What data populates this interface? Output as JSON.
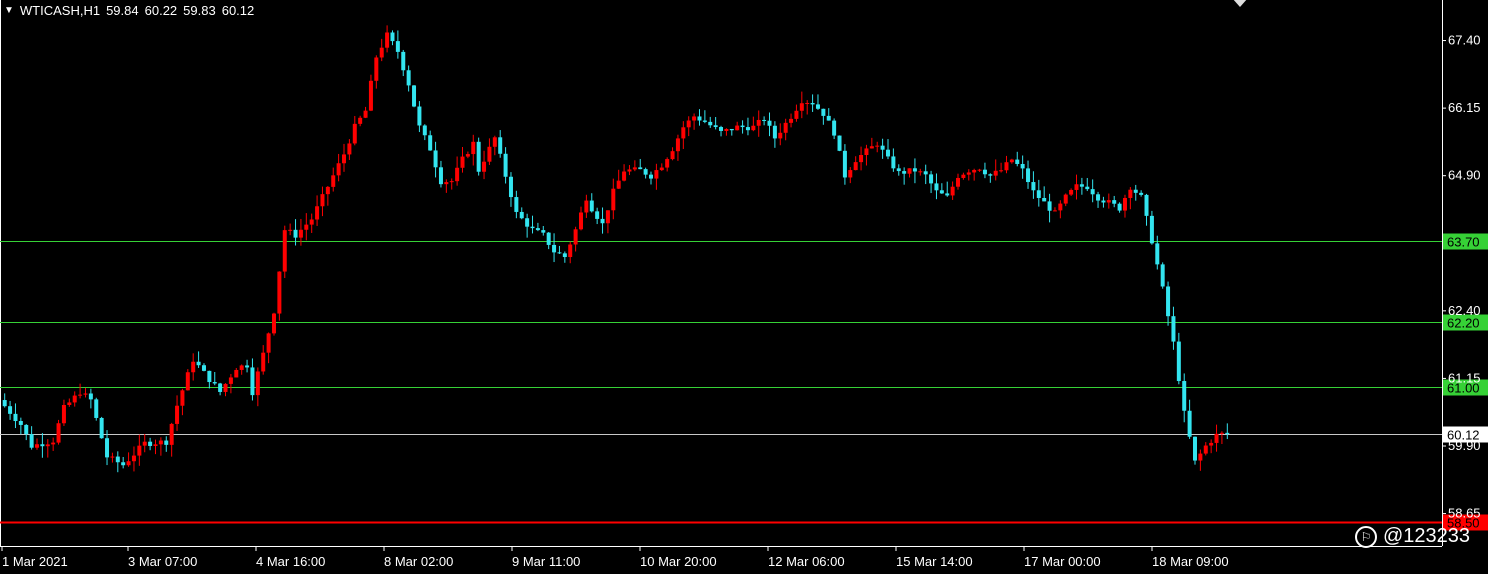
{
  "header": {
    "symbol": "WTICASH,H1",
    "open": "59.84",
    "high": "60.22",
    "low": "59.83",
    "close": "60.12"
  },
  "watermark": "@123233",
  "colors": {
    "background": "#000000",
    "bull": "#ff0000",
    "bear": "#33e5f0",
    "level_line": "#36d136",
    "support_line": "#ff0000",
    "current_line": "#c8c8c8",
    "axis_text": "#ffffff"
  },
  "chart_data": {
    "type": "candlestick",
    "y_axis_ticks": [
      "67.40",
      "66.15",
      "64.90",
      "62.40",
      "61.15",
      "59.90",
      "58.65"
    ],
    "ylim": [
      58.05,
      68.15
    ],
    "x_axis_labels": [
      "1 Mar 2021",
      "3 Mar 07:00",
      "4 Mar 16:00",
      "8 Mar 02:00",
      "9 Mar 11:00",
      "10 Mar 20:00",
      "12 Mar 06:00",
      "15 Mar 14:00",
      "17 Mar 00:00",
      "18 Mar 09:00"
    ],
    "levels": [
      {
        "value": 63.7,
        "label": "63.70",
        "kind": "resistance"
      },
      {
        "value": 62.2,
        "label": "62.20",
        "kind": "resistance"
      },
      {
        "value": 61.0,
        "label": "61.00",
        "kind": "resistance"
      },
      {
        "value": 58.5,
        "label": "58.50",
        "kind": "support"
      }
    ],
    "current_price": {
      "value": 60.12,
      "label": "60.12"
    },
    "price_path": [
      [
        0,
        60.75
      ],
      [
        4,
        60.3
      ],
      [
        6,
        59.9
      ],
      [
        10,
        60.0
      ],
      [
        12,
        60.6
      ],
      [
        15,
        60.9
      ],
      [
        17,
        60.75
      ],
      [
        20,
        59.7
      ],
      [
        23,
        59.55
      ],
      [
        27,
        59.95
      ],
      [
        31,
        59.98
      ],
      [
        33,
        60.65
      ],
      [
        36,
        61.5
      ],
      [
        38,
        61.25
      ],
      [
        41,
        60.9
      ],
      [
        44,
        61.35
      ],
      [
        46,
        61.4
      ],
      [
        47,
        60.9
      ],
      [
        49,
        61.6
      ],
      [
        51,
        62.4
      ],
      [
        53,
        63.9
      ],
      [
        55,
        63.8
      ],
      [
        58,
        64.1
      ],
      [
        61,
        64.7
      ],
      [
        64,
        65.3
      ],
      [
        66,
        65.8
      ],
      [
        68,
        66.1
      ],
      [
        70,
        67.1
      ],
      [
        72,
        67.5
      ],
      [
        74,
        67.2
      ],
      [
        76,
        66.6
      ],
      [
        78,
        65.8
      ],
      [
        80,
        65.4
      ],
      [
        82,
        64.8
      ],
      [
        84,
        64.8
      ],
      [
        86,
        65.2
      ],
      [
        88,
        65.5
      ],
      [
        89,
        65.0
      ],
      [
        92,
        65.6
      ],
      [
        94,
        64.9
      ],
      [
        96,
        64.2
      ],
      [
        99,
        63.9
      ],
      [
        101,
        63.8
      ],
      [
        103,
        63.5
      ],
      [
        105,
        63.4
      ],
      [
        107,
        63.9
      ],
      [
        109,
        64.5
      ],
      [
        110,
        64.3
      ],
      [
        112,
        64.0
      ],
      [
        114,
        64.6
      ],
      [
        116,
        65.0
      ],
      [
        119,
        65.0
      ],
      [
        121,
        64.9
      ],
      [
        123,
        65.1
      ],
      [
        125,
        65.4
      ],
      [
        127,
        65.8
      ],
      [
        129,
        66.0
      ],
      [
        131,
        65.9
      ],
      [
        134,
        65.7
      ],
      [
        137,
        65.8
      ],
      [
        140,
        65.8
      ],
      [
        142,
        65.95
      ],
      [
        144,
        65.6
      ],
      [
        147,
        66.0
      ],
      [
        149,
        66.3
      ],
      [
        151,
        66.25
      ],
      [
        153,
        66.05
      ],
      [
        155,
        65.7
      ],
      [
        157,
        64.9
      ],
      [
        159,
        65.2
      ],
      [
        161,
        65.35
      ],
      [
        163,
        65.5
      ],
      [
        165,
        65.2
      ],
      [
        167,
        64.95
      ],
      [
        170,
        65.0
      ],
      [
        172,
        64.9
      ],
      [
        174,
        64.6
      ],
      [
        176,
        64.5
      ],
      [
        178,
        64.9
      ],
      [
        180,
        65.0
      ],
      [
        182,
        65.05
      ],
      [
        184,
        64.9
      ],
      [
        186,
        65.0
      ],
      [
        188,
        65.2
      ],
      [
        190,
        65.0
      ],
      [
        192,
        64.6
      ],
      [
        194,
        64.4
      ],
      [
        196,
        64.2
      ],
      [
        198,
        64.5
      ],
      [
        200,
        64.7
      ],
      [
        202,
        64.7
      ],
      [
        204,
        64.5
      ],
      [
        206,
        64.4
      ],
      [
        208,
        64.3
      ],
      [
        210,
        64.7
      ],
      [
        212,
        64.5
      ],
      [
        214,
        63.7
      ],
      [
        216,
        62.8
      ],
      [
        218,
        61.8
      ],
      [
        220,
        60.5
      ],
      [
        222,
        59.6
      ],
      [
        224,
        59.9
      ],
      [
        226,
        60.1
      ],
      [
        227,
        60.12
      ]
    ]
  }
}
